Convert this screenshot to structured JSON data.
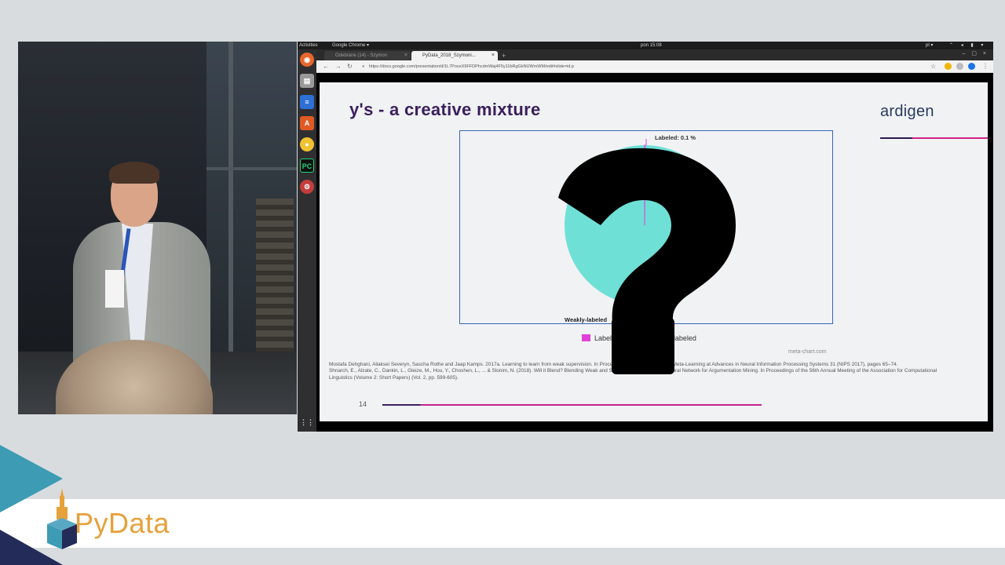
{
  "topbar": {
    "activities": "Activities",
    "app": "Google Chrome ▾",
    "clock": "pon 15:08",
    "lang": "pl ▾"
  },
  "browser": {
    "tabs": [
      {
        "label": "Odebrane (14) - Szymon",
        "active": false
      },
      {
        "label": "PyData_2018_Szymoni...",
        "active": true
      }
    ],
    "new_tab": "+",
    "url": "https://docs.google.com/presentation/d/1L7PooxX9FFDPhcdmWaj4F5y11bRgGkNUWmWM/edit#slide=id.p"
  },
  "slide": {
    "title": "y's - a creative mixture",
    "brand": "ardigen",
    "legend": [
      {
        "label": "Labeled",
        "color": "#e040d8"
      },
      {
        "label": "Weakly-labeled",
        "color": "#6fe0d6"
      }
    ],
    "credit": "meta-chart.com",
    "references": [
      "Mostafa Dehghani, Aliaksei Severyn, Sascha Rothe and Jaap Kamps. 2017a. Learning to learn from weak supervision. In Proceedings of the workshop on Meta-Learning at Advances in Neural Information Processing Systems 31 (NIPS 2017), pages 65–74.",
      "Shnarch, E., Alzate, C., Dankin, L., Gleize, M., Hou, Y., Choshen, L., ... & Slonim, N. (2018). Will it Blend? Blending Weak and Strong Labeled Data in a Neural Network for Argumentation Mining. In Proceedings of the 56th Annual Meeting of the Association for Computational Linguistics (Volume 2: Short Papers) (Vol. 2, pp. 599-605)."
    ],
    "page_number": "14"
  },
  "chart_data": {
    "type": "pie",
    "categories": [
      "Labeled",
      "Weakly-labeled"
    ],
    "values": [
      0.1,
      99.9
    ],
    "colors": [
      "#e040d8",
      "#6fe0d6"
    ],
    "data_labels": [
      "Labeled: 0.1 %",
      "Weakly-labeled"
    ],
    "legend": "bottom"
  },
  "overlay": {
    "icon": "question-mark-icon",
    "color": "#000000"
  },
  "event": {
    "logo_text": "PyData",
    "accent": "#e6a13a",
    "teal": "#3d9bb3",
    "navy": "#232c59"
  }
}
